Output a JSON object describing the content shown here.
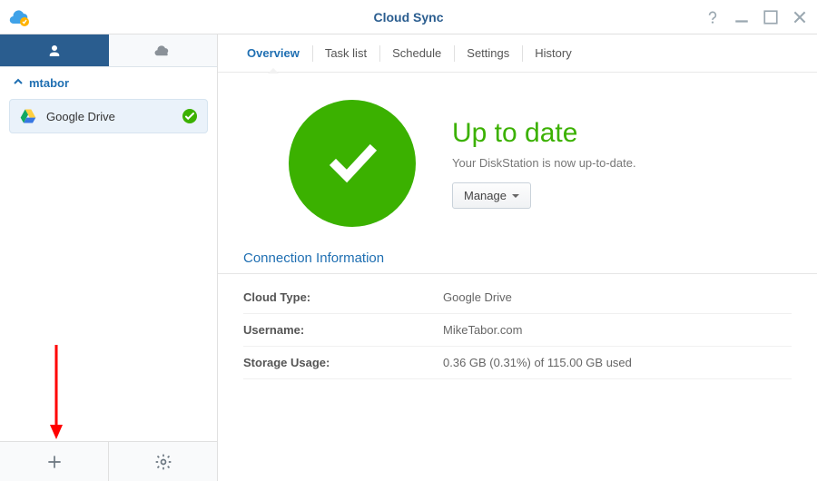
{
  "window": {
    "title": "Cloud Sync"
  },
  "sidebar": {
    "account": "mtabor",
    "connections": [
      {
        "label": "Google Drive"
      }
    ]
  },
  "tabs": {
    "overview": "Overview",
    "tasklist": "Task list",
    "schedule": "Schedule",
    "settings": "Settings",
    "history": "History"
  },
  "status": {
    "heading": "Up to date",
    "subtext": "Your DiskStation is now up-to-date.",
    "manage_label": "Manage"
  },
  "conn_info": {
    "section_title": "Connection Information",
    "labels": {
      "cloud_type": "Cloud Type:",
      "username": "Username:",
      "storage": "Storage Usage:"
    },
    "values": {
      "cloud_type": "Google Drive",
      "username": "MikeTabor.com",
      "storage": "0.36 GB (0.31%) of 115.00 GB used"
    }
  }
}
